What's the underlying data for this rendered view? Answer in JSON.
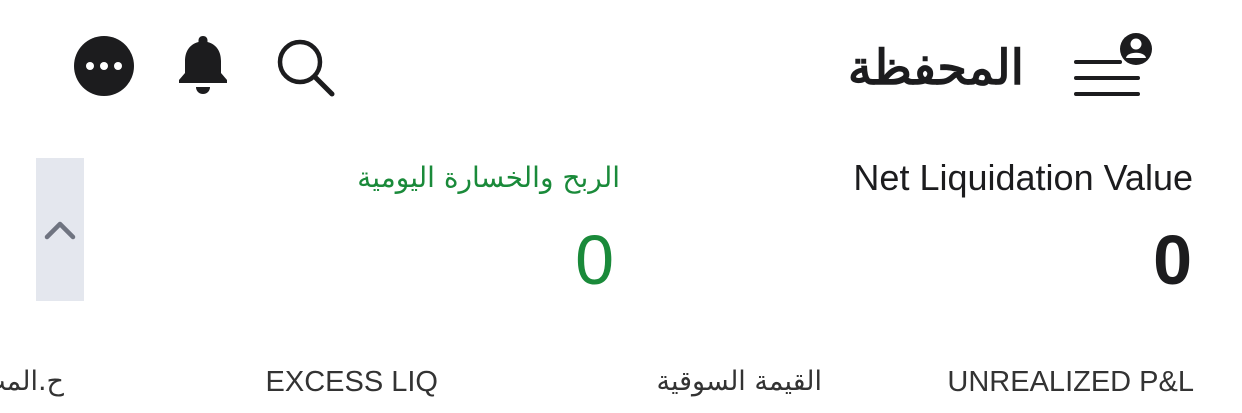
{
  "header": {
    "title": "المحفظة",
    "icons": {
      "more": "more-dots-icon",
      "bell": "bell-icon",
      "search": "search-icon",
      "menu": "menu-profile-icon"
    }
  },
  "summary": {
    "net_liquidation": {
      "label": "Net Liquidation Value",
      "value": "0"
    },
    "daily_pnl": {
      "label": "الربح والخسارة اليومية",
      "value": "0",
      "color": "#1a8a3a"
    },
    "collapse_icon": "chevron-up-icon"
  },
  "columns": {
    "unrealized_pnl": "UNREALIZED P&L",
    "market_value": "القيمة السوقية",
    "excess_liq": "EXCESS LIQ",
    "partial": "ح.المت"
  },
  "colors": {
    "primary_text": "#1c1c1e",
    "positive": "#1a8a3a",
    "collapse_bg": "#e4e7ee"
  }
}
